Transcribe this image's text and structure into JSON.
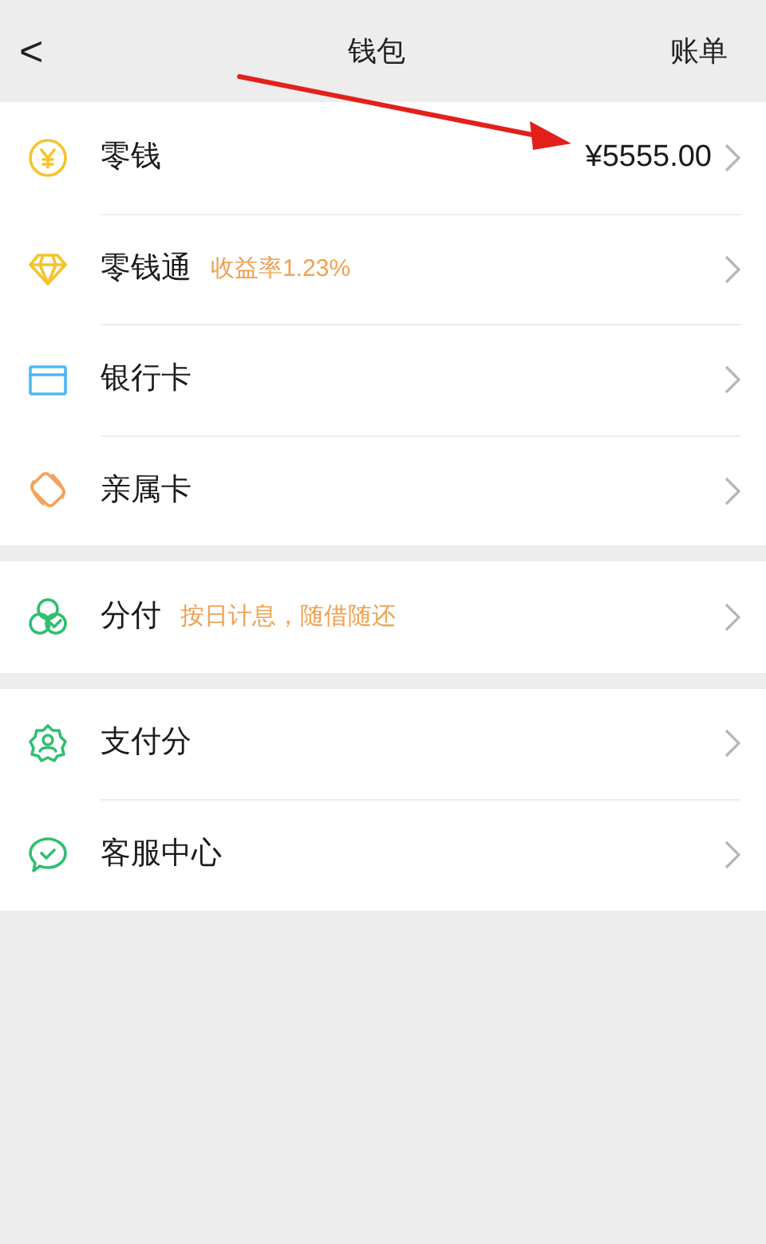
{
  "header": {
    "back": "<",
    "title": "钱包",
    "action": "账单"
  },
  "sections": [
    {
      "items": [
        {
          "label": "零钱",
          "value": "¥5555.00"
        },
        {
          "label": "零钱通",
          "note": "收益率1.23%"
        },
        {
          "label": "银行卡"
        },
        {
          "label": "亲属卡"
        }
      ]
    },
    {
      "items": [
        {
          "label": "分付",
          "note": "按日计息，随借随还"
        }
      ]
    },
    {
      "items": [
        {
          "label": "支付分"
        },
        {
          "label": "客服中心"
        }
      ]
    }
  ]
}
